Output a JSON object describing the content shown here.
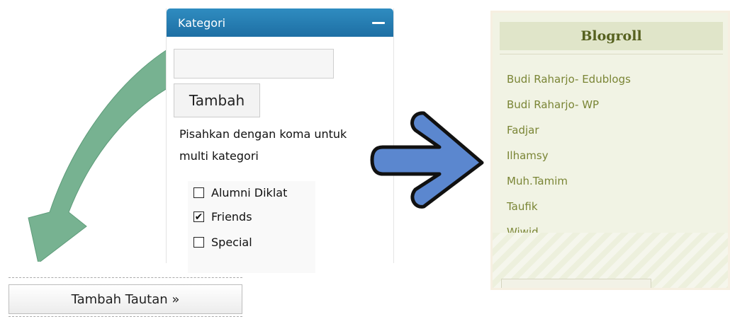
{
  "category_panel": {
    "title": "Kategori",
    "input_value": "",
    "add_button_label": "Tambah",
    "hint_line1": "Pisahkan dengan koma untuk",
    "hint_line2": "multi kategori",
    "items": [
      {
        "label": "Alumni Diklat",
        "checked": false
      },
      {
        "label": "Friends",
        "checked": true
      },
      {
        "label": "Special",
        "checked": false
      }
    ]
  },
  "blogroll": {
    "title": "Blogroll",
    "links": [
      "Budi Raharjo- Edublogs",
      "Budi Raharjo- WP",
      "Fadjar",
      "Ilhamsy",
      "Muh.Tamim",
      "Taufik",
      "Wiwid"
    ]
  },
  "add_link_button": {
    "label": "Tambah Tautan »"
  },
  "colors": {
    "header_blue": "#2a82b9",
    "green_arrow": "#77b291",
    "blue_arrow": "#5b87cf",
    "blogroll_link": "#7a8535"
  },
  "icons": {
    "collapse": "minus-icon",
    "arrows": [
      "green-curved-arrow-icon",
      "blue-right-arrow-icon"
    ]
  }
}
